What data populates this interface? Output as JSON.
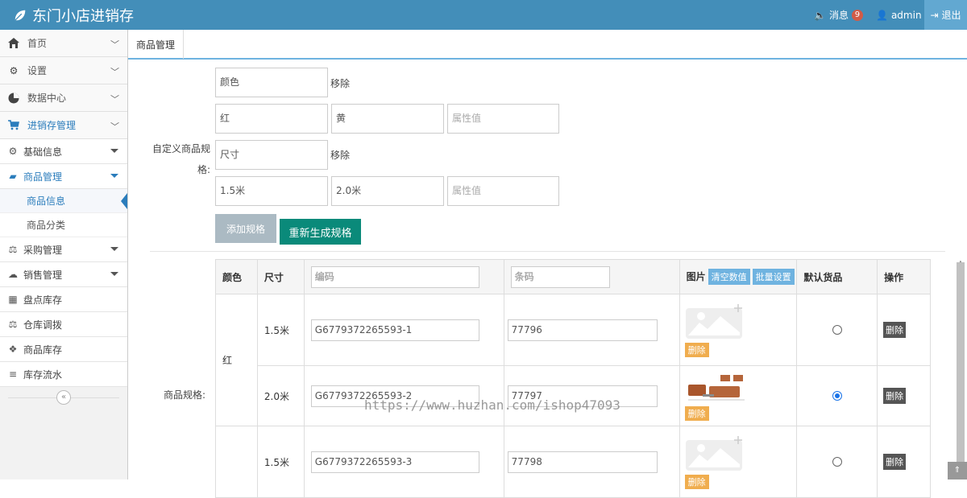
{
  "header": {
    "title": "东门小店进销存",
    "messages_label": "消息",
    "messages_count": "9",
    "user": "admin",
    "logout": "退出"
  },
  "sidebar": {
    "items": [
      {
        "label": "首页",
        "icon": "home-icon"
      },
      {
        "label": "设置",
        "icon": "gear-icon"
      },
      {
        "label": "数据中心",
        "icon": "pie-chart-icon"
      },
      {
        "label": "进销存管理",
        "icon": "cart-icon"
      }
    ],
    "groups": [
      {
        "label": "基础信息",
        "icon": "cogs-icon"
      },
      {
        "label": "商品管理",
        "icon": "bag-icon"
      },
      {
        "label": "采购管理",
        "icon": "balance-icon"
      },
      {
        "label": "销售管理",
        "icon": "cloud-icon"
      },
      {
        "label": "盘点库存",
        "icon": "grid-icon"
      },
      {
        "label": "仓库调拨",
        "icon": "balance-icon"
      },
      {
        "label": "商品库存",
        "icon": "cubes-icon"
      },
      {
        "label": "库存流水",
        "icon": "list-icon"
      }
    ],
    "product_leaves": [
      {
        "label": "商品信息"
      },
      {
        "label": "商品分类"
      }
    ],
    "collapse_icon": "double-chevron-left-icon"
  },
  "tabs": [
    {
      "label": "商品管理"
    }
  ],
  "form": {
    "custom_spec_label": "自定义商品规格:",
    "spec_label": "商品规格:",
    "remove_label": "移除",
    "attr_placeholder": "属性值",
    "spec1": {
      "name": "颜色",
      "values": [
        "红",
        "黄"
      ]
    },
    "spec2": {
      "name": "尺寸",
      "values": [
        "1.5米",
        "2.0米"
      ]
    },
    "add_spec_button": "添加规格",
    "regen_button": "重新生成规格"
  },
  "table": {
    "headers": {
      "color": "颜色",
      "size": "尺寸",
      "code_placeholder": "编码",
      "barcode_placeholder": "条码",
      "image": "图片",
      "clear_btn": "清空数值",
      "batch_btn": "批量设置",
      "default": "默认货品",
      "action": "操作"
    },
    "delete_label": "删除",
    "image_delete_label": "删除",
    "rows": [
      {
        "color": "红",
        "size": "1.5米",
        "code": "G6779372265593-1",
        "barcode": "77796",
        "image": "placeholder-image",
        "default": false
      },
      {
        "color": "",
        "size": "2.0米",
        "code": "G6779372265593-2",
        "barcode": "77797",
        "image": "sofa-photo",
        "default": true
      },
      {
        "color": "",
        "size": "1.5米",
        "code": "G6779372265593-3",
        "barcode": "77798",
        "image": "placeholder-image",
        "default": false
      }
    ]
  },
  "watermark": "https://www.huzhan.com/ishop47093",
  "colors": {
    "header": "#438eb9",
    "accent": "#2b7dbc",
    "green": "#0a8a7a"
  }
}
